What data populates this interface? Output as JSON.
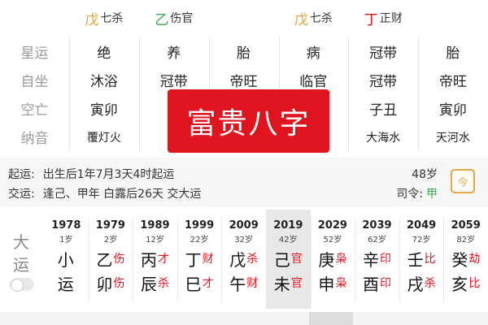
{
  "top_row": [
    {
      "stem": "",
      "god": "",
      "stem_color": "#e4a640"
    },
    {
      "stem": "",
      "god": "",
      "stem_color": "#3aa64b"
    },
    {
      "stem": "",
      "god": "",
      "stem_color": "#e4a640"
    },
    {
      "stem": "",
      "god": "",
      "stem_color": "#e0141e"
    },
    {
      "stem": "",
      "god": "",
      "stem_color": "#e0141e"
    },
    {
      "stem": "",
      "god": "",
      "stem_color": "#e4a640"
    }
  ],
  "top_row_visible": [
    {
      "stem": "戊",
      "god": "七杀",
      "stem_color": "#e4a640"
    },
    {
      "stem": "乙",
      "god": "伤官",
      "stem_color": "#3aa64b"
    },
    {
      "stem": "",
      "god": "",
      "stem_color": "#e4a640"
    },
    {
      "stem": "戊",
      "god": "七杀",
      "stem_color": "#e4a640"
    },
    {
      "stem": "丁",
      "god": "正财",
      "stem_color": "#e0141e"
    },
    {
      "stem": "",
      "god": "",
      "stem_color": "#e4a640"
    }
  ],
  "grid": {
    "rows": [
      {
        "label": "星运",
        "cells": [
          "绝",
          "养",
          "胎",
          "病",
          "冠带",
          "胎"
        ]
      },
      {
        "label": "自坐",
        "cells": [
          "沐浴",
          "冠带",
          "帝旺",
          "临官",
          "冠带",
          "帝旺"
        ]
      },
      {
        "label": "空亡",
        "cells": [
          "寅卯",
          "子",
          "",
          "",
          "子丑",
          "寅卯"
        ]
      },
      {
        "label": "纳音",
        "cells": [
          "覆灯火",
          "天",
          "",
          "",
          "大海水",
          "天河水"
        ]
      }
    ]
  },
  "overlay_text": "富贵八字",
  "info": {
    "qiyun_label": "起运:",
    "qiyun_text": "出生后1年7月3天4时起运",
    "jiaoyun_label": "交运:",
    "jiaoyun_text": "逢己、甲年 白露后26天 交大运",
    "age": "48岁",
    "siling_label": "司令:",
    "siling_value": "甲",
    "calendar_icon_text": "今",
    "accent": "#e4a640",
    "green": "#3aa64b"
  },
  "dayun": {
    "label_top": "大",
    "label_bottom": "运",
    "columns": [
      {
        "year": "1978",
        "age": "1岁",
        "top": "小",
        "top_god": "",
        "bottom": "运",
        "bottom_god": "",
        "active": false
      },
      {
        "year": "1979",
        "age": "2岁",
        "top": "乙",
        "top_god": "伤",
        "bottom": "卯",
        "bottom_god": "伤",
        "active": false
      },
      {
        "year": "1989",
        "age": "12岁",
        "top": "丙",
        "top_god": "才",
        "bottom": "辰",
        "bottom_god": "杀",
        "active": false
      },
      {
        "year": "1999",
        "age": "22岁",
        "top": "丁",
        "top_god": "财",
        "bottom": "巳",
        "bottom_god": "才",
        "active": false
      },
      {
        "year": "2009",
        "age": "32岁",
        "top": "戊",
        "top_god": "杀",
        "bottom": "午",
        "bottom_god": "财",
        "active": false
      },
      {
        "year": "2019",
        "age": "42岁",
        "top": "己",
        "top_god": "官",
        "bottom": "未",
        "bottom_god": "官",
        "active": true
      },
      {
        "year": "2029",
        "age": "52岁",
        "top": "庚",
        "top_god": "枭",
        "bottom": "申",
        "bottom_god": "枭",
        "active": false
      },
      {
        "year": "2039",
        "age": "62岁",
        "top": "辛",
        "top_god": "印",
        "bottom": "酉",
        "bottom_god": "印",
        "active": false
      },
      {
        "year": "2049",
        "age": "72岁",
        "top": "壬",
        "top_god": "比",
        "bottom": "戌",
        "bottom_god": "杀",
        "active": false
      },
      {
        "year": "2059",
        "age": "82岁",
        "top": "癸",
        "top_god": "劫",
        "bottom": "亥",
        "bottom_god": "比",
        "active": false
      }
    ],
    "god_color": "#e0141e"
  }
}
